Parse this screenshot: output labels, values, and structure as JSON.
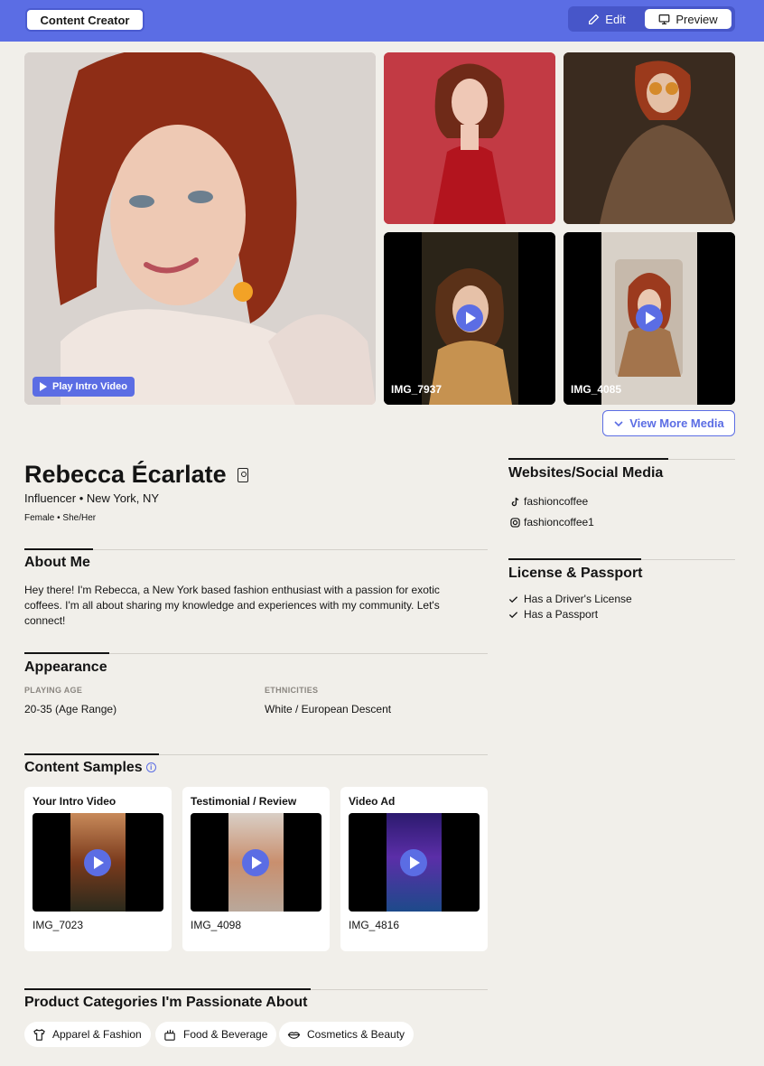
{
  "header": {
    "role_label": "Content Creator",
    "edit_label": "Edit",
    "preview_label": "Preview"
  },
  "gallery": {
    "play_intro_label": "Play Intro Video",
    "tiles": [
      {
        "caption": ""
      },
      {
        "caption": ""
      },
      {
        "caption": "IMG_7937"
      },
      {
        "caption": "IMG_4085"
      }
    ],
    "view_more_label": "View More Media"
  },
  "profile": {
    "name": "Rebecca Écarlate",
    "subline": "Influencer • New York, NY",
    "subline2": "Female • She/Her"
  },
  "about": {
    "title": "About Me",
    "text": "Hey there! I'm Rebecca, a New York based fashion enthusiast with a passion for exotic coffees. I'm all about sharing my knowledge and experiences with my community. Let's connect!"
  },
  "appearance": {
    "title": "Appearance",
    "playing_age_label": "PLAYING AGE",
    "playing_age_value": "20-35 (Age Range)",
    "ethnicities_label": "ETHNICITIES",
    "ethnicities_value": "White / European Descent"
  },
  "content_samples": {
    "title": "Content Samples",
    "info_icon": "i",
    "items": [
      {
        "title": "Your Intro Video",
        "file": "IMG_7023"
      },
      {
        "title": "Testimonial / Review",
        "file": "IMG_4098"
      },
      {
        "title": "Video Ad",
        "file": "IMG_4816"
      }
    ]
  },
  "categories": {
    "title": "Product Categories I'm Passionate About",
    "items": [
      {
        "label": "Apparel & Fashion",
        "icon": "shirt-icon"
      },
      {
        "label": "Food & Beverage",
        "icon": "food-icon"
      },
      {
        "label": "Cosmetics & Beauty",
        "icon": "lips-icon"
      }
    ]
  },
  "social": {
    "title": "Websites/Social Media",
    "items": [
      {
        "platform": "tiktok-icon",
        "handle": "fashioncoffee"
      },
      {
        "platform": "instagram-icon",
        "handle": "fashioncoffee1"
      }
    ]
  },
  "license": {
    "title": "License & Passport",
    "items": [
      {
        "label": "Has a Driver's License"
      },
      {
        "label": "Has a Passport"
      }
    ]
  },
  "colors": {
    "accent": "#5b6de4",
    "background": "#f1efea"
  }
}
